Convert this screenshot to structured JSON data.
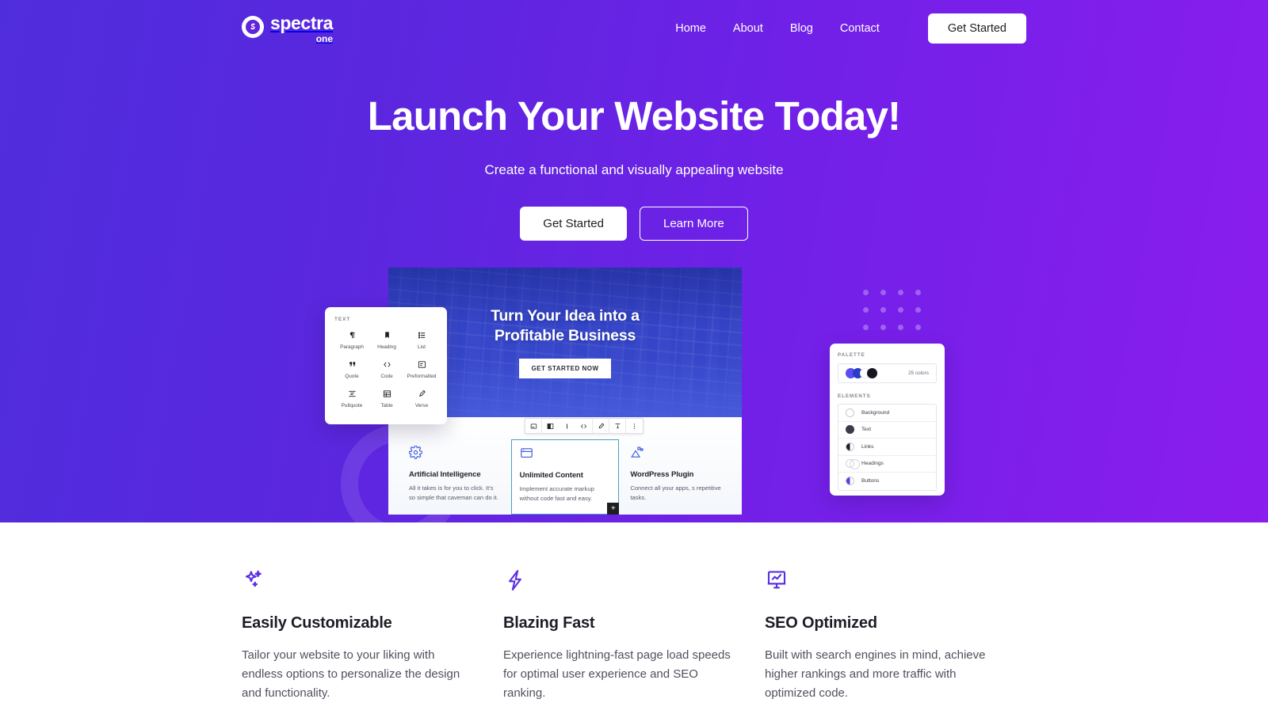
{
  "brand": {
    "logo_main": "spectra",
    "logo_sub": "one",
    "logo_icon": "spectra-s-mark"
  },
  "nav": {
    "links": [
      {
        "label": "Home"
      },
      {
        "label": "About"
      },
      {
        "label": "Blog"
      },
      {
        "label": "Contact"
      }
    ],
    "cta_label": "Get Started"
  },
  "hero": {
    "title": "Launch Your Website Today!",
    "subtitle": "Create a functional and visually appealing website",
    "primary_button": "Get Started",
    "secondary_button": "Learn More",
    "gradient_from": "#4f2ddd",
    "gradient_to": "#8b1dee"
  },
  "mock": {
    "banner": {
      "title_line1": "Turn Your Idea into a",
      "title_line2": "Profitable Business",
      "button_label": "GET STARTED NOW"
    },
    "cards": [
      {
        "icon": "gear-icon",
        "title": "Artificial Intelligence",
        "text": "All it takes is for you to click. It's so simple that caveman can do it."
      },
      {
        "icon": "browser-window-icon",
        "title": "Unlimited Content",
        "text": "Implement accurate markup without code fast and easy.",
        "selected": true,
        "plus_label": "+"
      },
      {
        "icon": "plugin-icon",
        "title": "WordPress Plugin",
        "text": "Connect all your apps, s repetitive tasks."
      }
    ],
    "toolbar": {
      "items": [
        "block-type-icon",
        "align-icon",
        "bold-icon",
        "code-icon",
        "link-icon",
        "highlight-icon",
        "more-options-icon"
      ]
    },
    "inserter": {
      "heading": "TEXT",
      "items": [
        {
          "label": "Paragraph",
          "icon": "paragraph-icon"
        },
        {
          "label": "Heading",
          "icon": "heading-icon"
        },
        {
          "label": "List",
          "icon": "list-icon"
        },
        {
          "label": "Quote",
          "icon": "quote-icon"
        },
        {
          "label": "Code",
          "icon": "code-icon"
        },
        {
          "label": "Preformatted",
          "icon": "preformatted-icon"
        },
        {
          "label": "Pullquote",
          "icon": "pullquote-icon"
        },
        {
          "label": "Table",
          "icon": "table-icon"
        },
        {
          "label": "Verse",
          "icon": "verse-icon"
        }
      ]
    },
    "palette": {
      "heading": "PALETTE",
      "color_count": "25 colors",
      "swatches": [
        "#5a4ff3",
        "#2b3ccc",
        "#ffffff",
        "#16161e"
      ],
      "elements_heading": "ELEMENTS",
      "elements": [
        {
          "label": "Background",
          "swatch": "empty"
        },
        {
          "label": "Text",
          "swatch": "dark"
        },
        {
          "label": "Links",
          "swatch": "half"
        },
        {
          "label": "Headings",
          "swatch": "rings"
        },
        {
          "label": "Buttons",
          "swatch": "blue-half"
        }
      ]
    }
  },
  "features": [
    {
      "icon": "sparkles-icon",
      "title": "Easily Customizable",
      "text": "Tailor your website to your liking with endless options to personalize the design and functionality."
    },
    {
      "icon": "lightning-bolt-icon",
      "title": "Blazing Fast",
      "text": "Experience lightning-fast page load speeds for optimal user experience and SEO ranking."
    },
    {
      "icon": "chart-presentation-icon",
      "title": "SEO Optimized",
      "text": "Built with search engines in mind, achieve higher rankings and more traffic with optimized code."
    }
  ]
}
